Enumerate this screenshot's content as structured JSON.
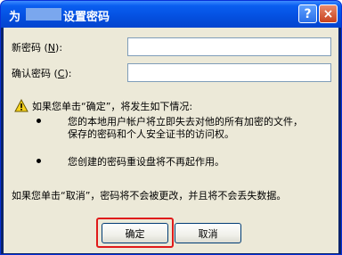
{
  "window": {
    "title_prefix": "为",
    "title": "设置密码",
    "help_glyph": "?",
    "close_glyph": "×"
  },
  "form": {
    "new_password_label": "新密码",
    "new_password_key": "N",
    "confirm_password_label": "确认密码",
    "confirm_password_key": "C",
    "label_suffix": ":",
    "new_password_value": "",
    "confirm_password_value": ""
  },
  "warning": {
    "intro": "如果您单击“确定”，将发生如下情况:",
    "bullet1_line1": "您的本地用户帐户将立即失去对他的所有加密的文件，",
    "bullet1_line2": "保存的密码和个人安全证书的访问权。",
    "bullet2": "您创建的密码重设盘将不再起作用。",
    "cancel_note": "如果您单击“取消”，密码将不会被更改，并且将不会丢失数据。"
  },
  "buttons": {
    "ok_label": "确定",
    "cancel_label": "取消"
  },
  "icons": {
    "warning": "warning-icon",
    "help": "help-icon",
    "close": "close-icon"
  }
}
